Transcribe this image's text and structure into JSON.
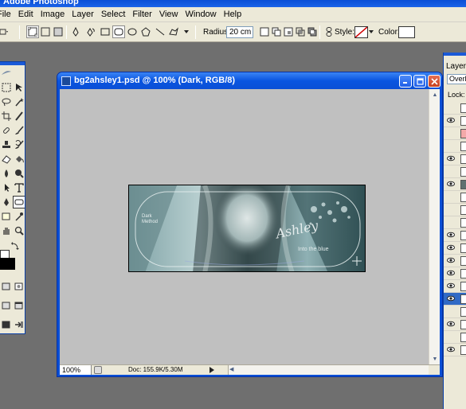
{
  "app": {
    "title": "Adobe Photoshop"
  },
  "menu": [
    "File",
    "Edit",
    "Image",
    "Layer",
    "Select",
    "Filter",
    "View",
    "Window",
    "Help"
  ],
  "options": {
    "radius_label": "Radius:",
    "radius_value": "20 cm",
    "style_label": "Style:",
    "color_label": "Color:"
  },
  "document": {
    "title": "bg2ahsley1.psd @ 100% (Dark, RGB/8)",
    "zoom": "100%",
    "doc_size": "Doc: 155.9K/5.30M"
  },
  "artwork": {
    "left_text_line1": "Dark",
    "left_text_line2": "Method",
    "signature": "Ashley",
    "tagline": "Into the blue"
  },
  "layers": {
    "tab": "Layers",
    "blend_mode": "Overlay",
    "lock_label": "Lock:",
    "rows": [
      {
        "visible": false
      },
      {
        "visible": true
      },
      {
        "visible": false
      },
      {
        "visible": false
      },
      {
        "visible": true
      },
      {
        "visible": false
      },
      {
        "visible": true
      },
      {
        "visible": false
      },
      {
        "visible": false
      },
      {
        "visible": false
      },
      {
        "visible": true
      },
      {
        "visible": true
      },
      {
        "visible": true
      },
      {
        "visible": true
      },
      {
        "visible": true
      },
      {
        "visible": true
      },
      {
        "visible": false
      },
      {
        "visible": true
      },
      {
        "visible": false
      },
      {
        "visible": true
      }
    ]
  },
  "colors": {
    "xp_title": "#0a4fd6",
    "chrome": "#ece9d8",
    "workspace": "#6f6f6f",
    "canvas_bg": "#c0c0c0",
    "artwork_base": "#2b4a4c"
  }
}
